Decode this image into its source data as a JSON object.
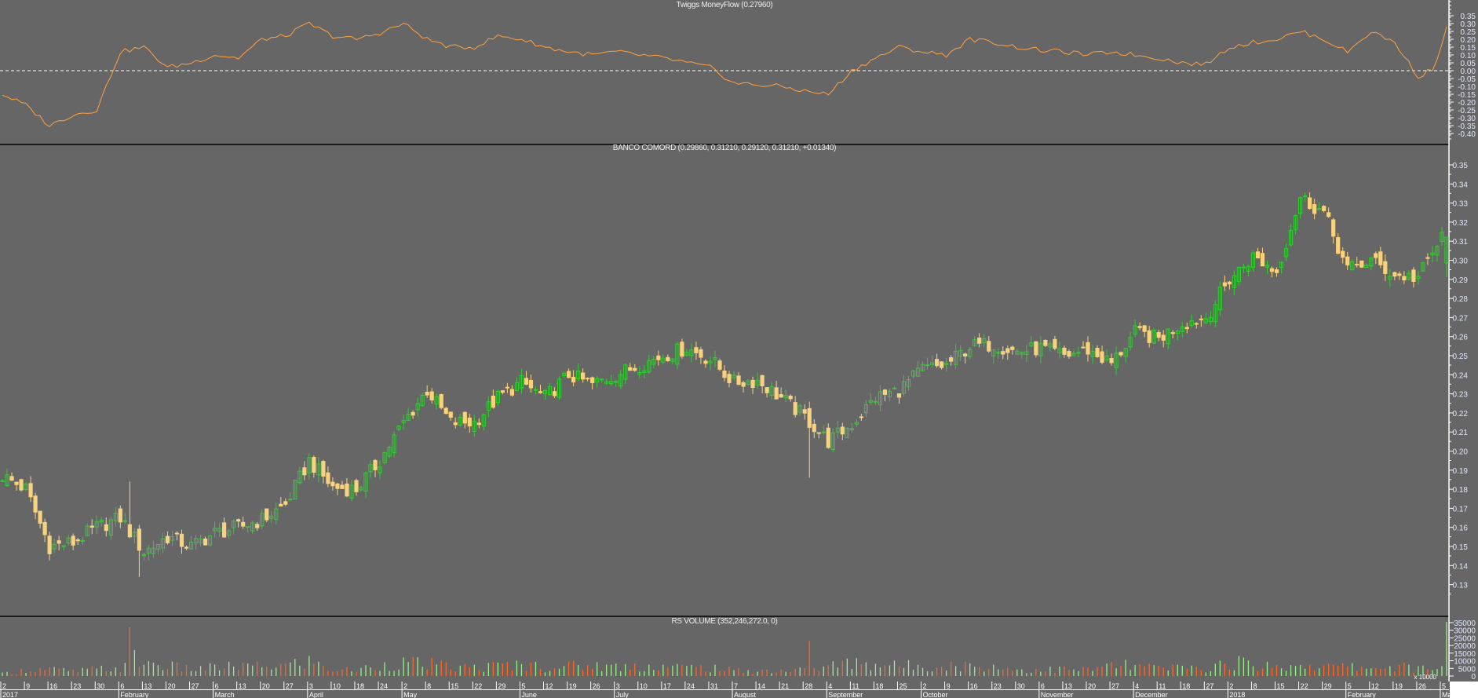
{
  "colors": {
    "background": "#666666",
    "up": "#33cc33",
    "down": "#f9d27c",
    "mf_line": "#ffa040",
    "vol_up": "#99ee88",
    "vol_down": "#ff6622",
    "axis": "#ffffff",
    "label": "#e0e8ff"
  },
  "chart_data": [
    {
      "type": "line",
      "title": "Twiggs MoneyFlow (0.27960)",
      "ylim": [
        -0.42,
        0.38
      ],
      "yticks": [
        "0.35",
        "0.30",
        "0.25",
        "0.20",
        "0.15",
        "0.10",
        "0.05",
        "0.00",
        "-0.05",
        "-0.10",
        "-0.15",
        "-0.20",
        "-0.25",
        "-0.30",
        "-0.35",
        "-0.40"
      ],
      "reference_line": 0.0,
      "weekly_values": [
        -0.15,
        -0.22,
        -0.35,
        -0.28,
        -0.25,
        0.12,
        0.15,
        0.02,
        0.05,
        0.1,
        0.08,
        0.2,
        0.22,
        0.3,
        0.22,
        0.2,
        0.24,
        0.3,
        0.2,
        0.15,
        0.15,
        0.22,
        0.2,
        0.15,
        0.12,
        0.1,
        0.12,
        0.1,
        0.08,
        0.05,
        0.02,
        -0.08,
        -0.09,
        -0.1,
        -0.13,
        -0.15,
        0.0,
        0.08,
        0.15,
        0.12,
        0.1,
        0.2,
        0.18,
        0.15,
        0.13,
        0.12,
        0.1,
        0.12,
        0.1,
        0.08,
        0.05,
        0.04,
        0.15,
        0.18,
        0.2,
        0.25,
        0.2,
        0.12,
        0.25,
        0.18,
        -0.04,
        0.05
      ],
      "last_value": 0.2796
    },
    {
      "type": "candlestick",
      "title": "BANCO COMORD (0.29860, 0.31210, 0.29120, 0.31210, +0.01340)",
      "ylim": [
        0.125,
        0.358
      ],
      "yticks": [
        "0.35",
        "0.34",
        "0.33",
        "0.32",
        "0.31",
        "0.30",
        "0.29",
        "0.28",
        "0.27",
        "0.26",
        "0.25",
        "0.24",
        "0.23",
        "0.22",
        "0.21",
        "0.20",
        "0.19",
        "0.18",
        "0.17",
        "0.16",
        "0.15",
        "0.14",
        "0.13"
      ],
      "weekly_closes": [
        0.187,
        0.18,
        0.15,
        0.152,
        0.16,
        0.165,
        0.147,
        0.155,
        0.15,
        0.157,
        0.16,
        0.164,
        0.172,
        0.195,
        0.181,
        0.18,
        0.195,
        0.215,
        0.232,
        0.215,
        0.215,
        0.228,
        0.236,
        0.228,
        0.24,
        0.235,
        0.24,
        0.245,
        0.25,
        0.254,
        0.248,
        0.236,
        0.237,
        0.228,
        0.218,
        0.205,
        0.214,
        0.228,
        0.232,
        0.243,
        0.245,
        0.255,
        0.256,
        0.252,
        0.254,
        0.25,
        0.253,
        0.246,
        0.262,
        0.259,
        0.267,
        0.27,
        0.29,
        0.302,
        0.294,
        0.333,
        0.325,
        0.295,
        0.3,
        0.292,
        0.291,
        0.312
      ],
      "last_bar": {
        "open": 0.2986,
        "high": 0.3121,
        "low": 0.2912,
        "close": 0.3121,
        "change": 0.0134
      }
    },
    {
      "type": "bar",
      "title": "RS VOLUME (352,246,272.0, 0)",
      "ylim": [
        0,
        37000
      ],
      "yticks": [
        "35000",
        "30000",
        "25000",
        "20000",
        "15000",
        "10000",
        "5000",
        "0"
      ],
      "unit_label": "x 10000",
      "weekly_volume": [
        1500,
        4000,
        4500,
        3000,
        4500,
        5000,
        9000,
        6500,
        4500,
        5500,
        6500,
        6000,
        7000,
        9500,
        4000,
        4000,
        7000,
        8500,
        8000,
        5500,
        5500,
        6500,
        7500,
        6000,
        6500,
        7000,
        6000,
        6500,
        6500,
        5500,
        5500,
        3500,
        3500,
        3500,
        4000,
        6000,
        9000,
        8000,
        6500,
        7000,
        7000,
        6500,
        6000,
        4000,
        4000,
        4500,
        4000,
        7000,
        6500,
        5000,
        5500,
        5000,
        8500,
        8000,
        5500,
        8000,
        6000,
        6000,
        5500,
        6500,
        4500,
        5500
      ],
      "spikes": [
        {
          "bar": 27,
          "value": 32000
        },
        {
          "bar": 28,
          "value": 17000
        },
        {
          "bar": 171,
          "value": 23000
        },
        {
          "bar": 306,
          "value": 35500
        }
      ]
    }
  ],
  "xaxis": {
    "day_labels": [
      "2",
      "9",
      "16",
      "23",
      "30",
      "6",
      "13",
      "20",
      "27",
      "6",
      "13",
      "20",
      "27",
      "3",
      "10",
      "18",
      "24",
      "2",
      "8",
      "15",
      "22",
      "29",
      "5",
      "12",
      "19",
      "26",
      "3",
      "10",
      "17",
      "24",
      "31",
      "7",
      "14",
      "21",
      "28",
      "4",
      "11",
      "18",
      "25",
      "2",
      "9",
      "16",
      "23",
      "30",
      "6",
      "13",
      "20",
      "27",
      "4",
      "11",
      "18",
      "27",
      "2",
      "8",
      "15",
      "22",
      "29",
      "5",
      "12",
      "19",
      "26",
      "5"
    ],
    "months": [
      {
        "label": "2017",
        "week": 0
      },
      {
        "label": "February",
        "week": 5
      },
      {
        "label": "March",
        "week": 9
      },
      {
        "label": "April",
        "week": 13
      },
      {
        "label": "May",
        "week": 17
      },
      {
        "label": "June",
        "week": 22
      },
      {
        "label": "July",
        "week": 26
      },
      {
        "label": "August",
        "week": 31
      },
      {
        "label": "September",
        "week": 35
      },
      {
        "label": "October",
        "week": 39
      },
      {
        "label": "November",
        "week": 44
      },
      {
        "label": "December",
        "week": 48
      },
      {
        "label": "2018",
        "week": 52
      },
      {
        "label": "February",
        "week": 57
      },
      {
        "label": "March",
        "week": 61
      }
    ]
  }
}
